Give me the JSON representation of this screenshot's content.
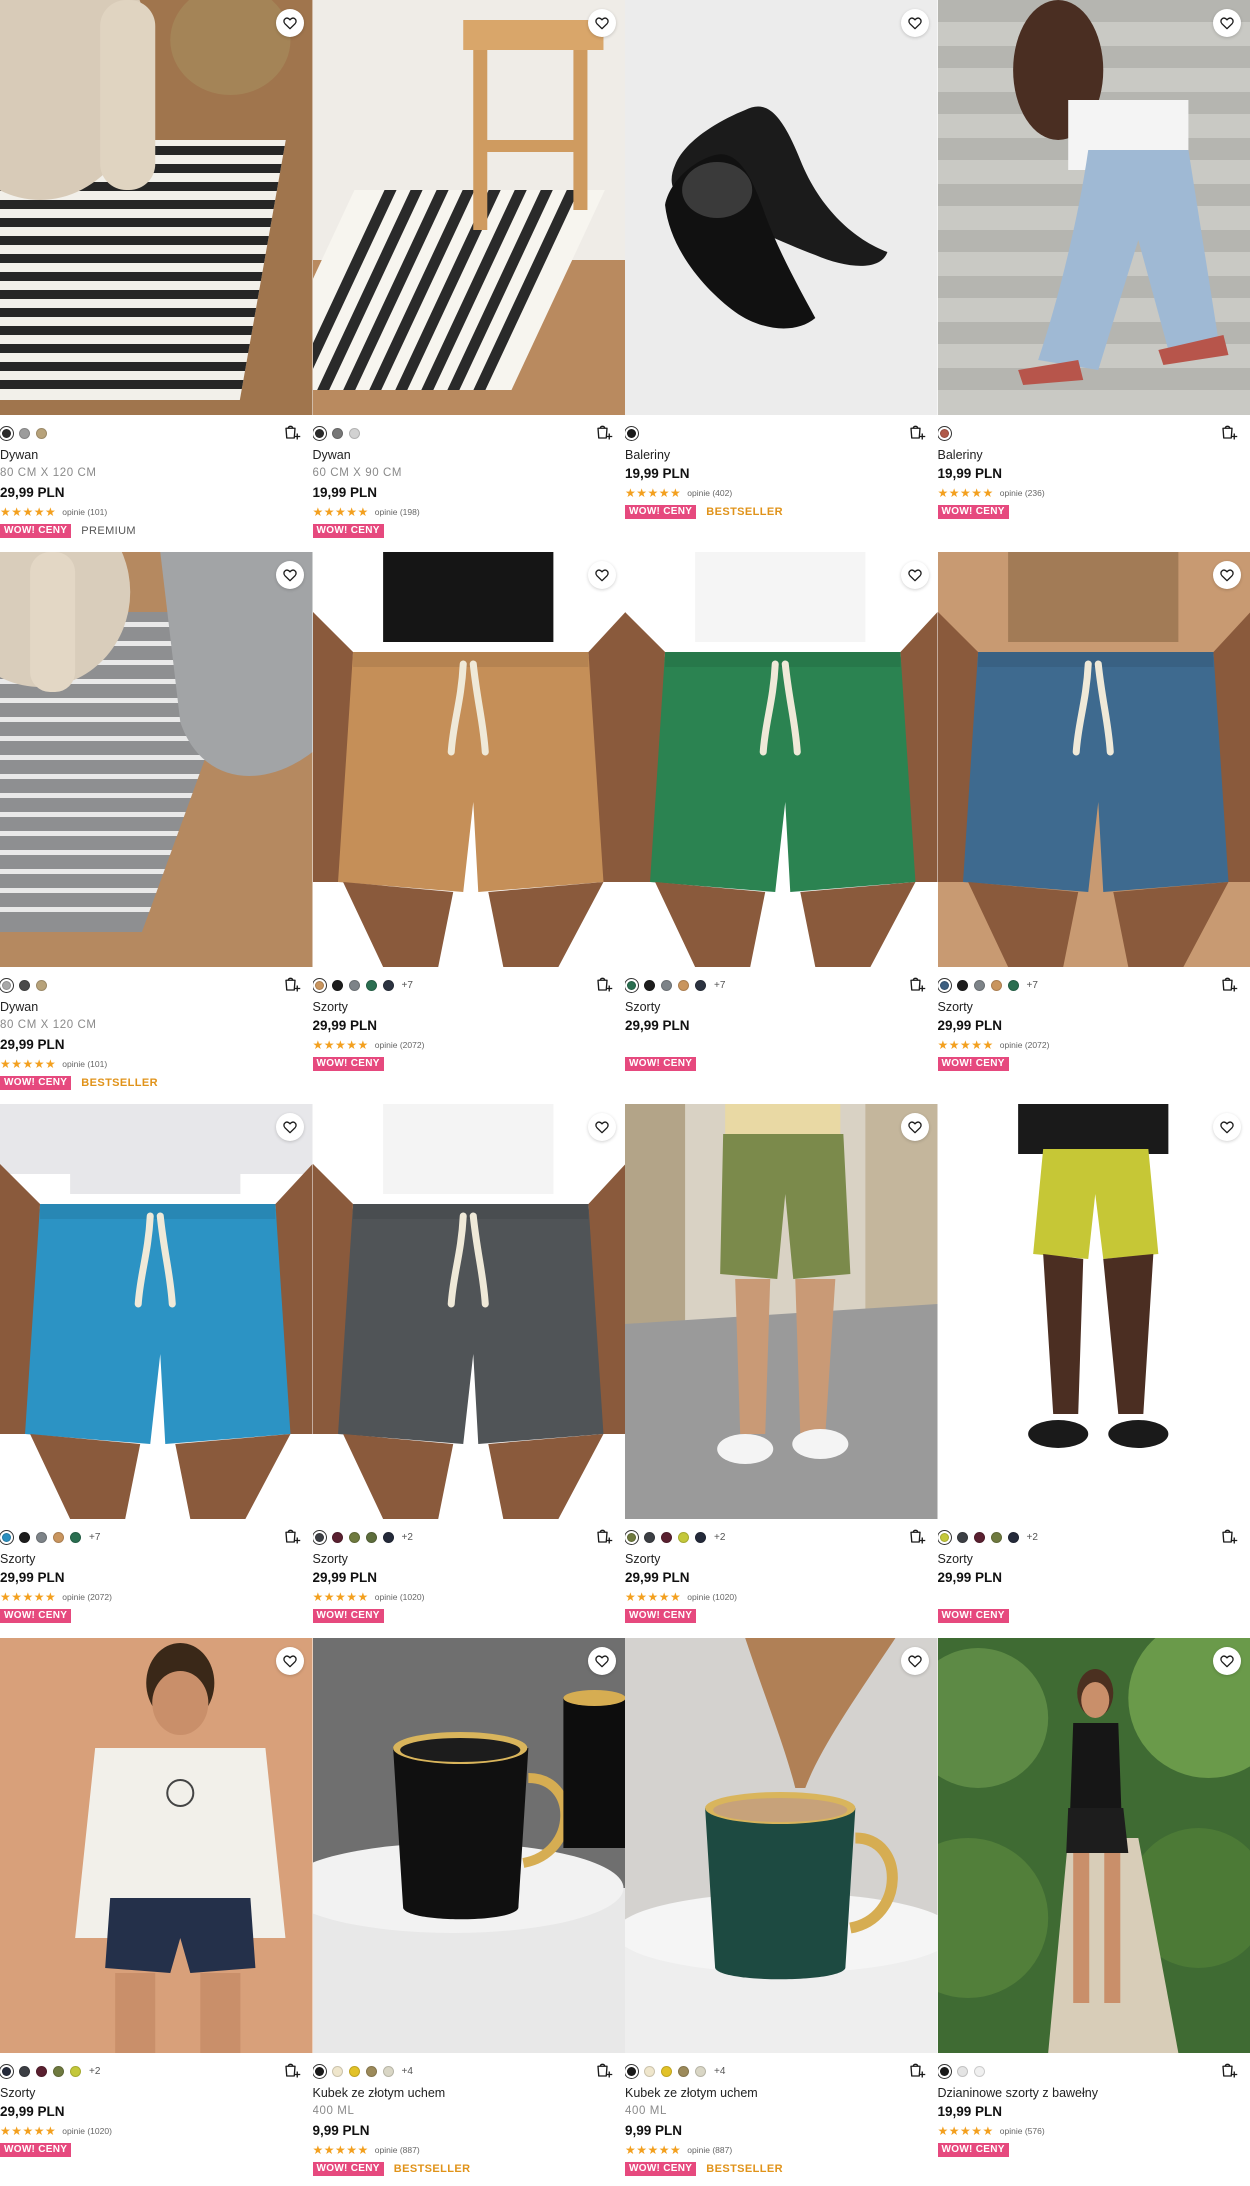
{
  "colors": {
    "wow_badge": "#e6497e",
    "bestseller": "#e0931a",
    "star": "#f3a01f"
  },
  "icons": {
    "favorite": "heart-icon",
    "add_to_cart": "cart-plus-icon"
  },
  "products": [
    {
      "name": "Dywan",
      "size": "80 CM X 120 CM",
      "price": "29,99 PLN",
      "rating": 4.5,
      "reviews": "opinie (101)",
      "swatches": [
        "#2b2b2b",
        "#9c9c9c",
        "#b7a27a"
      ],
      "more": "",
      "badge": "WOW! CENY",
      "tag": "PREMIUM",
      "tag_kind": "prem",
      "image": "rug-black-white"
    },
    {
      "name": "Dywan",
      "size": "60 CM X 90 CM",
      "price": "19,99 PLN",
      "rating": 5,
      "reviews": "opinie (198)",
      "swatches": [
        "#2b2b2b",
        "#777777",
        "#d2d2d2"
      ],
      "more": "",
      "badge": "WOW! CENY",
      "tag": "",
      "tag_kind": "",
      "image": "rug-stool"
    },
    {
      "name": "Baleriny",
      "size": "",
      "price": "19,99 PLN",
      "rating": 4.5,
      "reviews": "opinie (402)",
      "swatches": [
        "#1a1a1a"
      ],
      "more": "",
      "badge": "WOW! CENY",
      "tag": "BESTSELLER",
      "tag_kind": "best",
      "image": "flats-black"
    },
    {
      "name": "Baleriny",
      "size": "",
      "price": "19,99 PLN",
      "rating": 4.5,
      "reviews": "opinie (236)",
      "swatches": [
        "#b05a4a"
      ],
      "more": "",
      "badge": "WOW! CENY",
      "tag": "",
      "tag_kind": "",
      "image": "woman-stairs"
    },
    {
      "name": "Dywan",
      "size": "80 CM X 120 CM",
      "price": "29,99 PLN",
      "rating": 4.5,
      "reviews": "opinie (101)",
      "swatches": [
        "#a8a8a8",
        "#4a4a4a",
        "#b7a27a"
      ],
      "more": "",
      "badge": "WOW! CENY",
      "tag": "BESTSELLER",
      "tag_kind": "best",
      "image": "rug-gray"
    },
    {
      "name": "Szorty",
      "size": "",
      "price": "29,99 PLN",
      "rating": 5,
      "reviews": "opinie (2072)",
      "swatches": [
        "#c9955e",
        "#1d1d1d",
        "#7d8388",
        "#2a6e50",
        "#2c3340"
      ],
      "more": "+7",
      "badge": "WOW! CENY",
      "tag": "",
      "tag_kind": "",
      "image": "shorts-tan"
    },
    {
      "name": "Szorty",
      "size": "",
      "price": "29,99 PLN",
      "rating": 0,
      "reviews": "",
      "swatches": [
        "#2a6e50",
        "#1d1d1d",
        "#7d8388",
        "#c9955e",
        "#2c3340"
      ],
      "more": "+7",
      "badge": "WOW! CENY",
      "tag": "",
      "tag_kind": "",
      "image": "shorts-green"
    },
    {
      "name": "Szorty",
      "size": "",
      "price": "29,99 PLN",
      "rating": 5,
      "reviews": "opinie (2072)",
      "swatches": [
        "#3d5f80",
        "#1d1d1d",
        "#7d8388",
        "#c9955e",
        "#2a6e50"
      ],
      "more": "+7",
      "badge": "WOW! CENY",
      "tag": "",
      "tag_kind": "",
      "image": "shorts-navy"
    },
    {
      "name": "Szorty",
      "size": "",
      "price": "29,99 PLN",
      "rating": 5,
      "reviews": "opinie (2072)",
      "swatches": [
        "#2a8fbf",
        "#1d1d1d",
        "#7d8388",
        "#c9955e",
        "#2a6e50"
      ],
      "more": "+7",
      "badge": "WOW! CENY",
      "tag": "",
      "tag_kind": "",
      "image": "shorts-blue"
    },
    {
      "name": "Szorty",
      "size": "",
      "price": "29,99 PLN",
      "rating": 5,
      "reviews": "opinie (1020)",
      "swatches": [
        "#3c3f44",
        "#5a2030",
        "#6f7a3f",
        "#5d6d3c",
        "#242a3a"
      ],
      "more": "+2",
      "badge": "WOW! CENY",
      "tag": "",
      "tag_kind": "",
      "image": "shorts-charcoal"
    },
    {
      "name": "Szorty",
      "size": "",
      "price": "29,99 PLN",
      "rating": 5,
      "reviews": "opinie (1020)",
      "swatches": [
        "#6f7a3f",
        "#3c3f44",
        "#5a2030",
        "#c4c83a",
        "#242a3a"
      ],
      "more": "+2",
      "badge": "WOW! CENY",
      "tag": "",
      "tag_kind": "",
      "image": "shorts-olive"
    },
    {
      "name": "Szorty",
      "size": "",
      "price": "29,99 PLN",
      "rating": 0,
      "reviews": "",
      "swatches": [
        "#c4c83a",
        "#3c3f44",
        "#5a2030",
        "#6f7a3f",
        "#242a3a"
      ],
      "more": "+2",
      "badge": "WOW! CENY",
      "tag": "",
      "tag_kind": "",
      "image": "shorts-lime"
    },
    {
      "name": "Szorty",
      "size": "",
      "price": "29,99 PLN",
      "rating": 5,
      "reviews": "opinie (1020)",
      "swatches": [
        "#242a3a",
        "#3c3f44",
        "#5a2030",
        "#6f7a3f",
        "#c4c83a"
      ],
      "more": "+2",
      "badge": "WOW! CENY",
      "tag": "",
      "tag_kind": "",
      "image": "man-sweatshirt"
    },
    {
      "name": "Kubek ze złotym uchem",
      "size": "400 ML",
      "price": "9,99 PLN",
      "rating": 4.5,
      "reviews": "opinie (887)",
      "swatches": [
        "#1a1a1a",
        "#efe6cc",
        "#e2c228",
        "#9c8a5a",
        "#d9d6c5"
      ],
      "more": "+4",
      "badge": "WOW! CENY",
      "tag": "BESTSELLER",
      "tag_kind": "best",
      "image": "mug-black"
    },
    {
      "name": "Kubek ze złotym uchem",
      "size": "400 ML",
      "price": "9,99 PLN",
      "rating": 4.5,
      "reviews": "opinie (887)",
      "swatches": [
        "#1a1a1a",
        "#efe6cc",
        "#e2c228",
        "#9c8a5a",
        "#d9d6c5"
      ],
      "more": "+4",
      "badge": "WOW! CENY",
      "tag": "BESTSELLER",
      "tag_kind": "best",
      "image": "mug-green"
    },
    {
      "name": "Dzianinowe szorty z bawełny",
      "size": "",
      "price": "19,99 PLN",
      "rating": 5,
      "reviews": "opinie (576)",
      "swatches": [
        "#1a1a1a",
        "#e4e4e4",
        "#f0f0f0"
      ],
      "more": "",
      "badge": "WOW! CENY",
      "tag": "",
      "tag_kind": "",
      "image": "woman-path"
    }
  ]
}
